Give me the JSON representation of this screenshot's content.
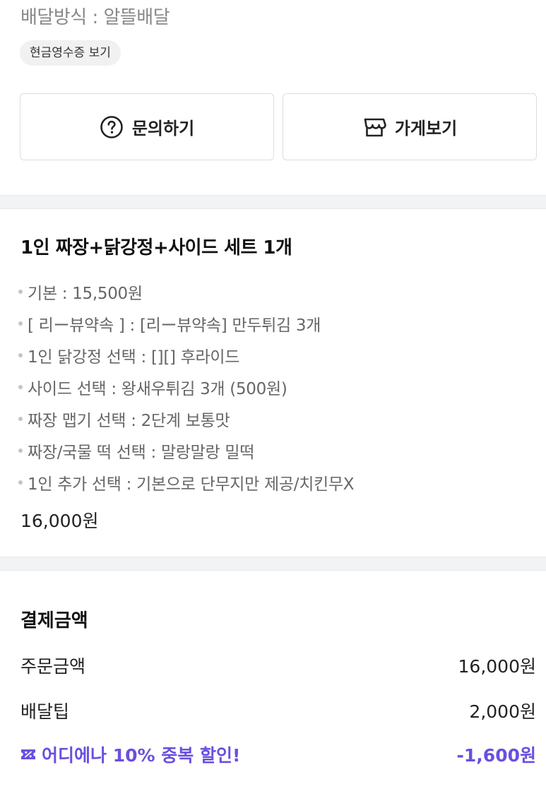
{
  "delivery": {
    "method_text": "배달방식 : 알뜰배달",
    "receipt_chip": "현금영수증 보기"
  },
  "actions": {
    "inquiry_label": "문의하기",
    "store_label": "가게보기"
  },
  "order": {
    "title": "1인 짜장+닭강정+사이드 세트 1개",
    "options": [
      "기본 : 15,500원",
      "[ 리ー뷰약속 ] : [리ー뷰약속] 만두튀김 3개",
      "1인 닭강정 선택 : [][] 후라이드",
      "사이드 선택 : 왕새우튀김 3개 (500원)",
      "짜장 맵기 선택 : 2단계 보통맛",
      "짜장/국물 떡 선택 : 말랑말랑 밀떡",
      "1인 추가 선택 : 기본으로 단무지만 제공/치킨무X"
    ],
    "price": "16,000원"
  },
  "payment": {
    "title": "결제금액",
    "order_amount_label": "주문금액",
    "order_amount_value": "16,000원",
    "delivery_tip_label": "배달팁",
    "delivery_tip_value": "2,000원",
    "discount_label": "어디에나 10% 중복 할인!",
    "discount_value": "-1,600원"
  },
  "colors": {
    "accent_purple": "#6b4fe0",
    "divider_gray": "#f2f3f5"
  },
  "icons": {
    "inquiry": "question-circle-icon",
    "store": "store-icon",
    "coupon": "coupon-icon"
  }
}
